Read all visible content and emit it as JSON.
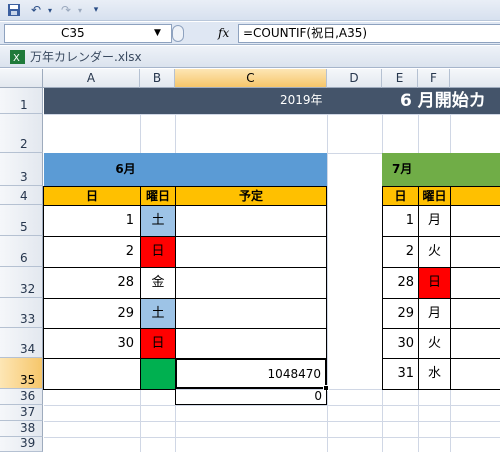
{
  "qat": {
    "icons": [
      "save-icon",
      "undo-icon",
      "redo-icon",
      "customize-icon"
    ]
  },
  "formula_bar": {
    "name_box": "C35",
    "fx_label": "fx",
    "formula": "=COUNTIF(祝日,A35)"
  },
  "workbook": {
    "title": "万年カレンダー.xlsx"
  },
  "columns": [
    "A",
    "B",
    "C",
    "D",
    "E",
    "F"
  ],
  "rows": [
    "1",
    "2",
    "3",
    "4",
    "5",
    "6",
    "32",
    "33",
    "34",
    "35",
    "36",
    "37",
    "38",
    "39"
  ],
  "sheet": {
    "year": "2019年",
    "title": "6 月開始カ",
    "june": {
      "header": "6月",
      "col_day": "日",
      "col_weekday": "曜日",
      "col_plan": "予定",
      "rows": [
        {
          "day": "1",
          "weekday": "土"
        },
        {
          "day": "2",
          "weekday": "日"
        },
        {
          "day": "28",
          "weekday": "金"
        },
        {
          "day": "29",
          "weekday": "土"
        },
        {
          "day": "30",
          "weekday": "日"
        }
      ],
      "c35_value": "1048470",
      "c36_value": "0"
    },
    "july": {
      "header": "7月",
      "col_day": "日",
      "col_weekday": "曜日",
      "rows": [
        {
          "day": "1",
          "weekday": "月"
        },
        {
          "day": "2",
          "weekday": "火"
        },
        {
          "day": "28",
          "weekday": "日"
        },
        {
          "day": "29",
          "weekday": "月"
        },
        {
          "day": "30",
          "weekday": "火"
        },
        {
          "day": "31",
          "weekday": "水"
        }
      ]
    }
  },
  "colors": {
    "title_bar": "#44546a",
    "june_header": "#5b9bd5",
    "july_header": "#70ad47",
    "col_header": "#ffc000",
    "saturday": "#9dc3e6",
    "sunday": "#ff0000",
    "green_fill": "#00b050"
  }
}
